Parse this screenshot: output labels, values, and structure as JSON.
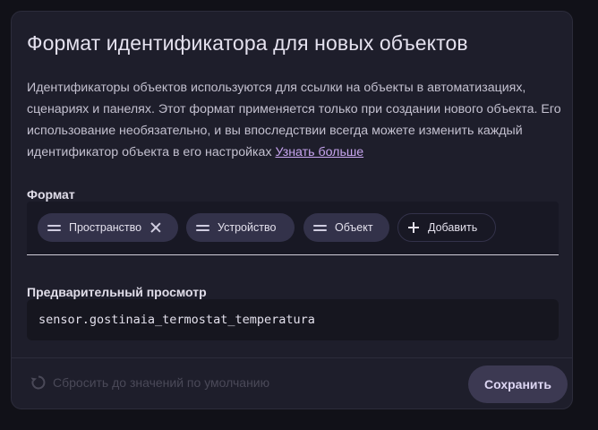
{
  "dialog": {
    "title": "Формат идентификатора для новых объектов",
    "description": "Идентификаторы объектов используются для ссылки на объекты в автоматизациях, сценариях и панелях. Этот формат применяется только при создании нового объекта. Его использование необязательно, и вы впоследствии всегда можете изменить каждый идентификатор объекта в его настройках",
    "learn_more_link": "Узнать больше",
    "format_label": "Формат",
    "chips": [
      {
        "label": "Пространство"
      },
      {
        "label": "Устройство"
      },
      {
        "label": "Объект"
      }
    ],
    "add_label": "Добавить",
    "preview_label": "Предварительный просмотр",
    "preview_value": "sensor.gostinaia_termostat_temperatura",
    "reset_label": "Сбросить до значений по умолчанию",
    "save_label": "Сохранить"
  },
  "icons": {
    "drag": "drag-handle-icon",
    "remove": "close-icon",
    "add": "plus-icon",
    "reset": "reset-icon"
  },
  "colors": {
    "card_bg": "#1e1e2b",
    "accent_link": "#c6a4ee",
    "chip_bg": "#33324a",
    "save_bg": "#3c3952"
  }
}
